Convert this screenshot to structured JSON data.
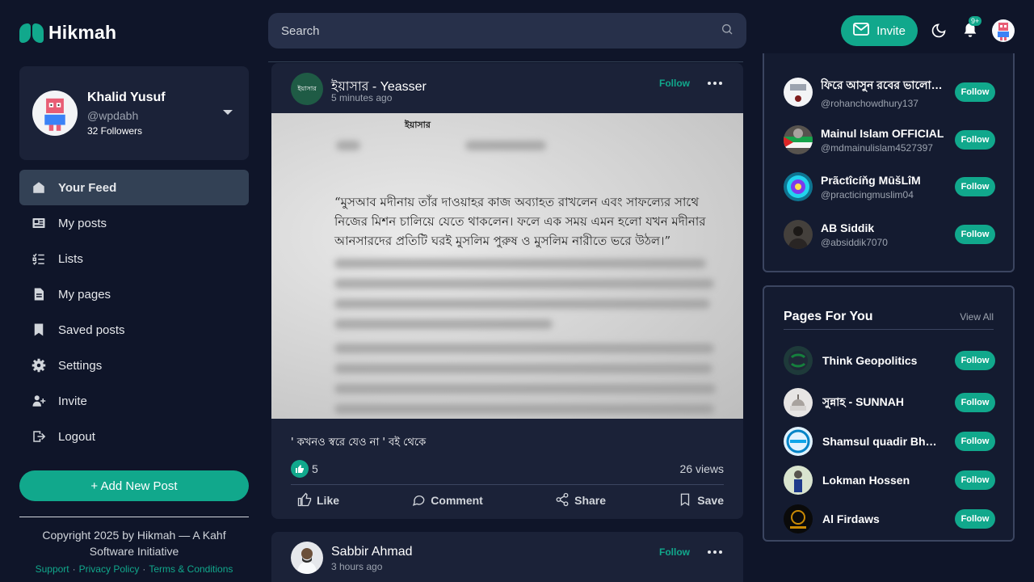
{
  "app": {
    "name": "Hikmah"
  },
  "search": {
    "placeholder": "Search"
  },
  "header": {
    "invite_label": "Invite",
    "notification_badge": "9+"
  },
  "profile": {
    "name": "Khalid Yusuf",
    "handle": "@wpdabh",
    "followers": "32 Followers"
  },
  "nav": {
    "items": [
      {
        "label": "Your Feed",
        "icon": "home-icon",
        "active": true
      },
      {
        "label": "My posts",
        "icon": "newspaper-icon"
      },
      {
        "label": "Lists",
        "icon": "checklist-icon"
      },
      {
        "label": "My pages",
        "icon": "document-icon"
      },
      {
        "label": "Saved posts",
        "icon": "bookmark-icon"
      },
      {
        "label": "Settings",
        "icon": "gear-icon"
      },
      {
        "label": "Invite",
        "icon": "user-plus-icon"
      },
      {
        "label": "Logout",
        "icon": "logout-icon"
      }
    ]
  },
  "add_post_label": "+ Add New Post",
  "footer": {
    "copyright": "Copyright 2025 by Hikmah — A Kahf Software Initiative",
    "links": [
      "Support",
      "Privacy Policy",
      "Terms & Conditions"
    ]
  },
  "posts": [
    {
      "author": "ইয়াসার - Yeasser",
      "time": "5 minutes ago",
      "follow_label": "Follow",
      "image_brand": "ইয়াসার",
      "image_quote": "“মুসআব মদীনায় তাঁর দাওয়াহর কাজ অব্যাহত রাখলেন এবং সাফল্যের সাথে নিজের মিশন চালিয়ে যেতে থাকলেন। ফলে এক সময় এমন হলো যখন মদীনার আনসারদের প্রতিটি ঘরই মুসলিম পুরুষ ও মুসলিম নারীতে ভরে উঠল।”",
      "caption": "' কখনও স্বরে যেও না ' বই থেকে",
      "likes": "5",
      "views": "26 views",
      "actions": {
        "like": "Like",
        "comment": "Comment",
        "share": "Share",
        "save": "Save"
      }
    },
    {
      "author": "Sabbir Ahmad",
      "time": "3 hours ago",
      "follow_label": "Follow"
    }
  ],
  "suggestions": {
    "follow_label": "Follow",
    "items": [
      {
        "name": "ফিরে আসুন রবের ভালোবাসায়",
        "handle": "@rohanchowdhury137"
      },
      {
        "name": "Mainul Islam OFFICIAL",
        "handle": "@mdmainulislam4527397"
      },
      {
        "name": "Prãctîcíňg MūšLîM",
        "handle": "@practicingmuslim04"
      },
      {
        "name": "AB Siddik",
        "handle": "@absiddik7070"
      }
    ]
  },
  "pages_for_you": {
    "title": "Pages For You",
    "view_all": "View All",
    "follow_label": "Follow",
    "items": [
      {
        "name": "Think Geopolitics"
      },
      {
        "name": "সুন্নাহ - SUNNAH"
      },
      {
        "name": "Shamsul quadir Bhuiyan"
      },
      {
        "name": "Lokman Hossen"
      },
      {
        "name": "Al Firdaws"
      }
    ]
  },
  "colors": {
    "accent": "#11a88c",
    "background": "#0f1529",
    "card": "#1b2238"
  }
}
